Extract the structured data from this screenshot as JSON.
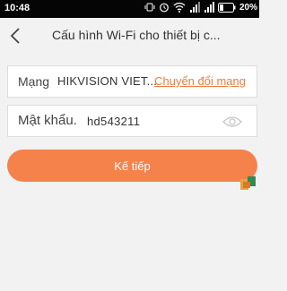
{
  "status_bar": {
    "time": "10:48",
    "battery": "20%",
    "icons": [
      "vibrate-icon",
      "alarm-icon",
      "wifi-icon",
      "signal-icon",
      "signal-icon",
      "battery-icon"
    ]
  },
  "header": {
    "title": "Cấu hình Wi-Fi cho thiết bị c..."
  },
  "network": {
    "label": "Mạng",
    "name": "HIKVISION VIET...",
    "change_label": "Chuyển đổi mạng"
  },
  "password": {
    "label": "Mật khẩu.",
    "value": "hd543211"
  },
  "next_button": {
    "label": "Kế tiếp"
  },
  "colors": {
    "accent": "#f4824a",
    "link": "#f07b3f",
    "background": "#f2f2f2"
  }
}
